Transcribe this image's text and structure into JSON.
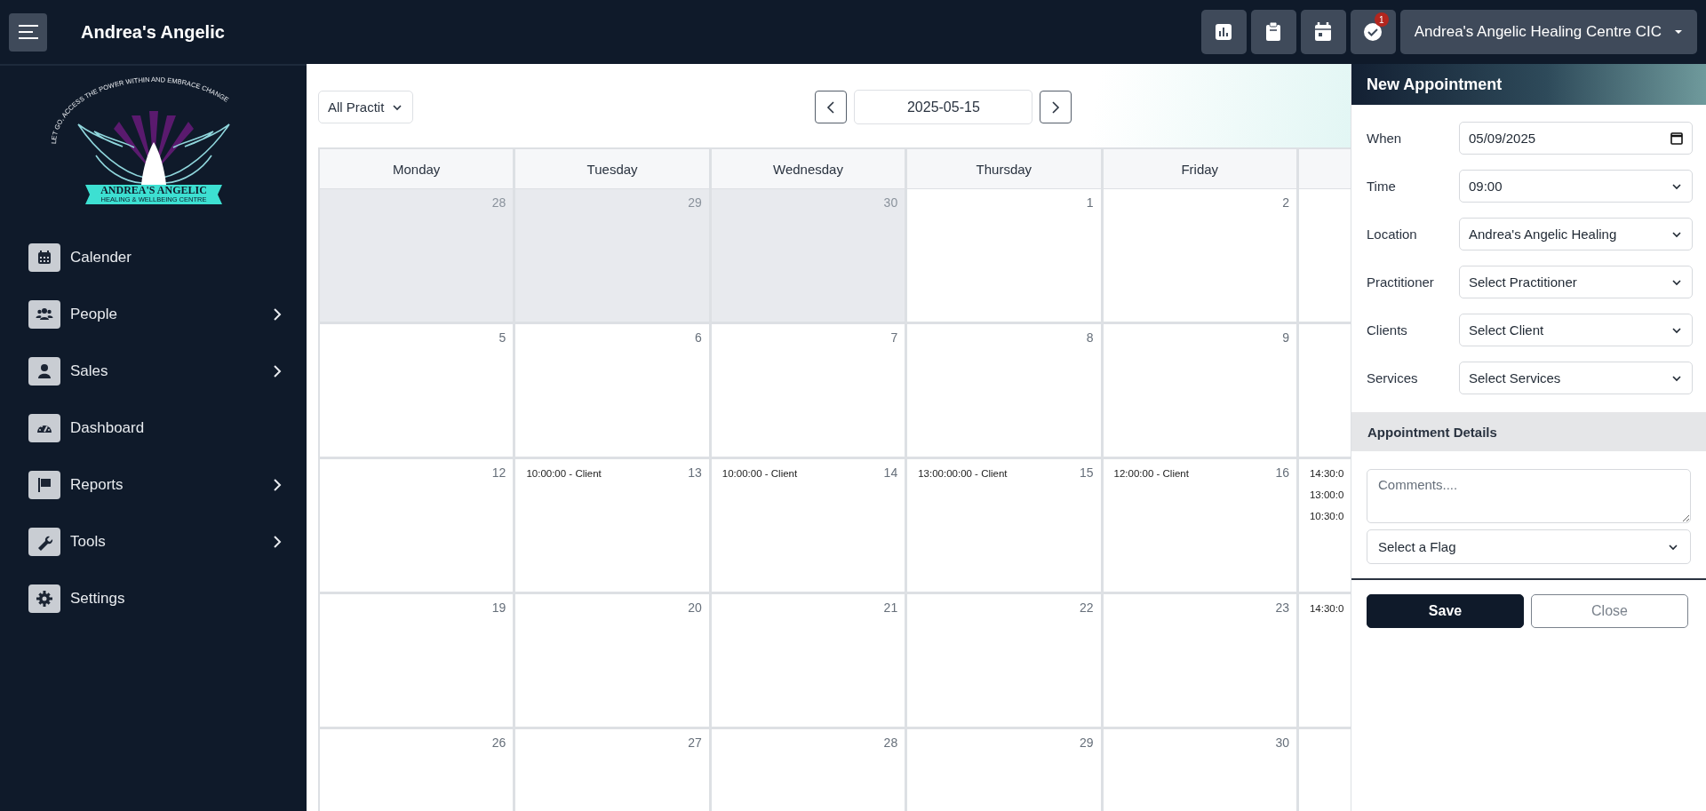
{
  "topbar": {
    "title": "Andrea's Angelic",
    "notification_count": "1",
    "account": "Andrea's Angelic Healing Centre CIC"
  },
  "logo": {
    "tagline": "LET GO, ACCESS THE POWER WITHIN AND EMBRACE CHANGE",
    "name": "ANDREA'S ANGELIC",
    "subtitle": "HEALING & WELLBEING CENTRE"
  },
  "sidebar": {
    "items": [
      {
        "label": "Calender",
        "has_submenu": false
      },
      {
        "label": "People",
        "has_submenu": true
      },
      {
        "label": "Sales",
        "has_submenu": true
      },
      {
        "label": "Dashboard",
        "has_submenu": false
      },
      {
        "label": "Reports",
        "has_submenu": true
      },
      {
        "label": "Tools",
        "has_submenu": true
      },
      {
        "label": "Settings",
        "has_submenu": false
      }
    ]
  },
  "calendar": {
    "filter": "All Practit",
    "date": "2025-05-15",
    "weekdays": [
      "Monday",
      "Tuesday",
      "Wednesday",
      "Thursday",
      "Friday"
    ],
    "weeks": [
      {
        "days": [
          {
            "day": "28",
            "outside_month": true
          },
          {
            "day": "29",
            "outside_month": true
          },
          {
            "day": "30",
            "outside_month": true
          },
          {
            "day": "1",
            "outside_month": false
          },
          {
            "day": "2",
            "outside_month": false
          }
        ]
      },
      {
        "days": [
          {
            "day": "5",
            "outside_month": false
          },
          {
            "day": "6",
            "outside_month": false
          },
          {
            "day": "7",
            "outside_month": false
          },
          {
            "day": "8",
            "outside_month": false
          },
          {
            "day": "9",
            "outside_month": false
          }
        ]
      },
      {
        "days": [
          {
            "day": "12",
            "outside_month": false
          },
          {
            "day": "13",
            "outside_month": false,
            "events": [
              "10:00:00 - Client"
            ]
          },
          {
            "day": "14",
            "outside_month": false,
            "events": [
              "10:00:00 - Client"
            ]
          },
          {
            "day": "15",
            "outside_month": false,
            "events": [
              "13:00:00:00 - Client"
            ]
          },
          {
            "day": "16",
            "outside_month": false,
            "events": [
              "12:00:00 - Client"
            ]
          }
        ],
        "column_6_events": [
          "14:30:0",
          "13:00:0",
          "10:30:0"
        ]
      },
      {
        "days": [
          {
            "day": "19",
            "outside_month": false
          },
          {
            "day": "20",
            "outside_month": false
          },
          {
            "day": "21",
            "outside_month": false
          },
          {
            "day": "22",
            "outside_month": false
          },
          {
            "day": "23",
            "outside_month": false
          }
        ],
        "column_6_events": [
          "14:30:0"
        ]
      },
      {
        "days": [
          {
            "day": "26",
            "outside_month": false
          },
          {
            "day": "27",
            "outside_month": false
          },
          {
            "day": "28",
            "outside_month": false
          },
          {
            "day": "29",
            "outside_month": false
          },
          {
            "day": "30",
            "outside_month": false
          }
        ]
      }
    ]
  },
  "panel": {
    "title": "New Appointment",
    "fields": [
      {
        "label": "When",
        "value": "05/09/2025",
        "kind": "date"
      },
      {
        "label": "Time",
        "value": "09:00",
        "kind": "select"
      },
      {
        "label": "Location",
        "value": "Andrea's Angelic Healing",
        "kind": "select"
      },
      {
        "label": "Practitioner",
        "value": "Select Practitioner",
        "kind": "select"
      },
      {
        "label": "Clients",
        "value": "Select Client",
        "kind": "select"
      },
      {
        "label": "Services",
        "value": "Select Services",
        "kind": "select"
      }
    ],
    "details_title": "Appointment Details",
    "comments": {
      "placeholder": "Comments...."
    },
    "flag": "Select a Flag",
    "buttons": [
      {
        "label": "Save",
        "kind": "primary"
      },
      {
        "label": "Close",
        "kind": "secondary"
      }
    ]
  }
}
